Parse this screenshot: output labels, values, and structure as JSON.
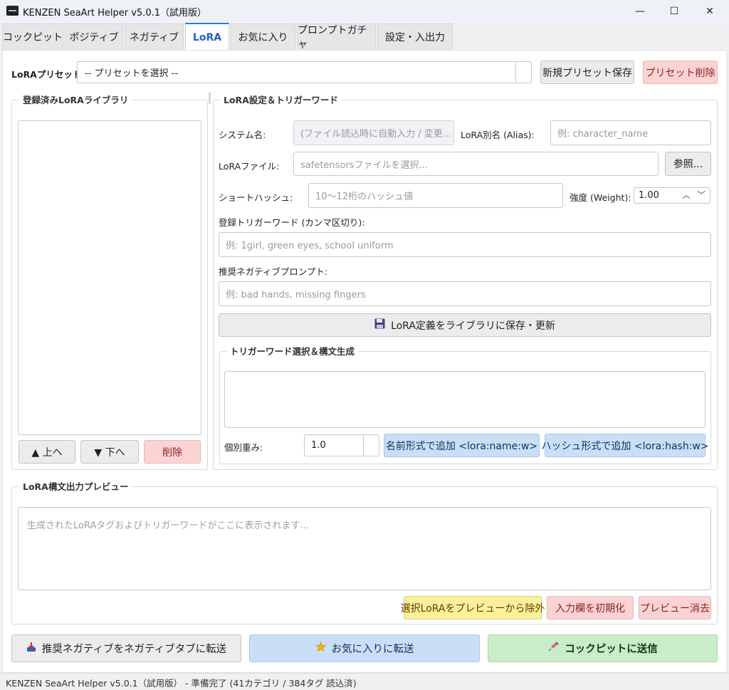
{
  "window": {
    "title": "KENZEN SeaArt Helper v5.0.1（試用版）",
    "minimize": "—",
    "maximize": "☐",
    "close": "✕"
  },
  "tabs": [
    {
      "label": "コックピット"
    },
    {
      "label": "ポジティブ"
    },
    {
      "label": "ネガティブ"
    },
    {
      "label": "LoRA",
      "active": true
    },
    {
      "label": "お気に入り"
    },
    {
      "label": "プロンプトガチャ"
    },
    {
      "label": "設定・入出力"
    }
  ],
  "preset": {
    "label": "LoRAプリセット:",
    "select_value": "-- プリセットを選択 --",
    "save_new": "新規プリセット保存",
    "delete": "プリセット削除"
  },
  "library": {
    "title": "登録済みLoRAライブラリ",
    "up": "▲ 上へ",
    "down": "▼ 下へ",
    "delete": "削除"
  },
  "settings": {
    "title": "LoRA設定＆トリガーワード",
    "system_name_label": "システム名:",
    "system_name_placeholder": "(ファイル読込時に自動入力 / 変更...",
    "alias_label": "LoRA別名 (Alias):",
    "alias_placeholder": "例: character_name",
    "file_label": "LoRAファイル:",
    "file_placeholder": "safetensorsファイルを選択...",
    "browse": "参照...",
    "hash_label": "ショートハッシュ:",
    "hash_placeholder": "10～12桁のハッシュ値",
    "weight_label": "強度 (Weight):",
    "weight_value": "1.00",
    "weight_up": "︿",
    "weight_down": "﹀",
    "trigger_label": "登録トリガーワード (カンマ区切り):",
    "trigger_placeholder": "例: 1girl, green eyes, school uniform",
    "neg_label": "推奨ネガティブプロンプト:",
    "neg_placeholder": "例: bad hands, missing fingers",
    "save_btn": "LoRA定義をライブラリに保存・更新",
    "save_icon": "floppy-disk"
  },
  "trigger_select": {
    "title": "トリガーワード選択＆構文生成",
    "weight_label": "個別重み:",
    "weight_value": "1.0",
    "add_name": "名前形式で追加 <lora:name:w>",
    "add_hash": "ハッシュ形式で追加 <lora:hash:w>"
  },
  "preview": {
    "title": "LoRA構文出力プレビュー",
    "placeholder": "生成されたLoRAタグおよびトリガーワードがここに表示されます...",
    "exclude": "選択LoRAをプレビューから除外",
    "reset": "入力欄を初期化",
    "clear": "プレビュー消去"
  },
  "bottom": {
    "neg_transfer": "推奨ネガティブをネガティブタブに転送",
    "neg_transfer_icon": "tray-download",
    "fav_transfer": "お気に入りに転送",
    "fav_transfer_icon": "star",
    "send": "コックピットに送信",
    "send_icon": "syringe"
  },
  "status": "KENZEN SeaArt Helper v5.0.1（試用版） - 準備完了 (41カテゴリ / 384タグ 読込済)"
}
